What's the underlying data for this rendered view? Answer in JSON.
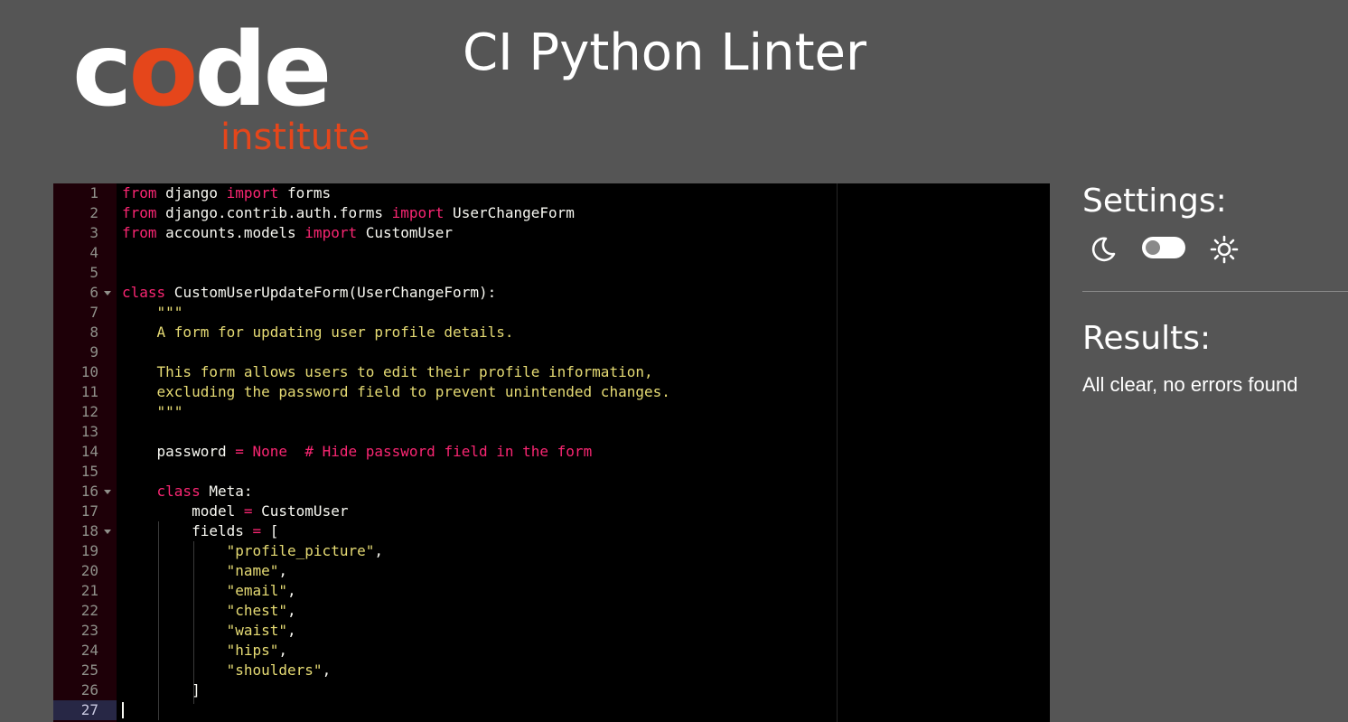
{
  "logo": {
    "code_parts": [
      "c",
      "o",
      "de"
    ],
    "subtitle": "institute"
  },
  "title": "CI Python Linter",
  "editor": {
    "active_line": 27,
    "lines": [
      [
        [
          "k",
          "from"
        ],
        [
          "t",
          " django "
        ],
        [
          "k",
          "import"
        ],
        [
          "t",
          " forms"
        ]
      ],
      [
        [
          "k",
          "from"
        ],
        [
          "t",
          " django.contrib.auth.forms "
        ],
        [
          "k",
          "import"
        ],
        [
          "t",
          " UserChangeForm"
        ]
      ],
      [
        [
          "k",
          "from"
        ],
        [
          "t",
          " accounts.models "
        ],
        [
          "k",
          "import"
        ],
        [
          "t",
          " CustomUser"
        ]
      ],
      [],
      [],
      [
        [
          "k",
          "class"
        ],
        [
          "t",
          " CustomUserUpdateForm(UserChangeForm):"
        ]
      ],
      [
        [
          "t",
          "    "
        ],
        [
          "s",
          "\"\"\""
        ]
      ],
      [
        [
          "s",
          "    A form for updating user profile details."
        ]
      ],
      [],
      [
        [
          "s",
          "    This form allows users to edit their profile information,"
        ]
      ],
      [
        [
          "s",
          "    excluding the password field to prevent unintended changes."
        ]
      ],
      [
        [
          "s",
          "    \"\"\""
        ]
      ],
      [],
      [
        [
          "t",
          "    password "
        ],
        [
          "k",
          "="
        ],
        [
          "t",
          " "
        ],
        [
          "k",
          "None"
        ],
        [
          "t",
          "  "
        ],
        [
          "c",
          "# Hide password field in the form"
        ]
      ],
      [],
      [
        [
          "t",
          "    "
        ],
        [
          "k",
          "class"
        ],
        [
          "t",
          " Meta:"
        ]
      ],
      [
        [
          "t",
          "        model "
        ],
        [
          "k",
          "="
        ],
        [
          "t",
          " CustomUser"
        ]
      ],
      [
        [
          "t",
          "        fields "
        ],
        [
          "k",
          "="
        ],
        [
          "t",
          " ["
        ]
      ],
      [
        [
          "t",
          "            "
        ],
        [
          "s",
          "\"profile_picture\""
        ],
        [
          "t",
          ","
        ]
      ],
      [
        [
          "t",
          "            "
        ],
        [
          "s",
          "\"name\""
        ],
        [
          "t",
          ","
        ]
      ],
      [
        [
          "t",
          "            "
        ],
        [
          "s",
          "\"email\""
        ],
        [
          "t",
          ","
        ]
      ],
      [
        [
          "t",
          "            "
        ],
        [
          "s",
          "\"chest\""
        ],
        [
          "t",
          ","
        ]
      ],
      [
        [
          "t",
          "            "
        ],
        [
          "s",
          "\"waist\""
        ],
        [
          "t",
          ","
        ]
      ],
      [
        [
          "t",
          "            "
        ],
        [
          "s",
          "\"hips\""
        ],
        [
          "t",
          ","
        ]
      ],
      [
        [
          "t",
          "            "
        ],
        [
          "s",
          "\"shoulders\""
        ],
        [
          "t",
          ","
        ]
      ],
      [
        [
          "t",
          "        ]"
        ]
      ],
      []
    ],
    "fold_lines": [
      6,
      16,
      18
    ]
  },
  "settings": {
    "heading": "Settings:",
    "theme_toggle": "dark"
  },
  "results": {
    "heading": "Results:",
    "message": "All clear, no errors found"
  },
  "colors": {
    "background": "#555555",
    "brand_orange": "#e5461b",
    "keyword": "#f92672",
    "string": "#e6db74",
    "text": "#f8f8f2",
    "gutter": "#1e0008"
  }
}
